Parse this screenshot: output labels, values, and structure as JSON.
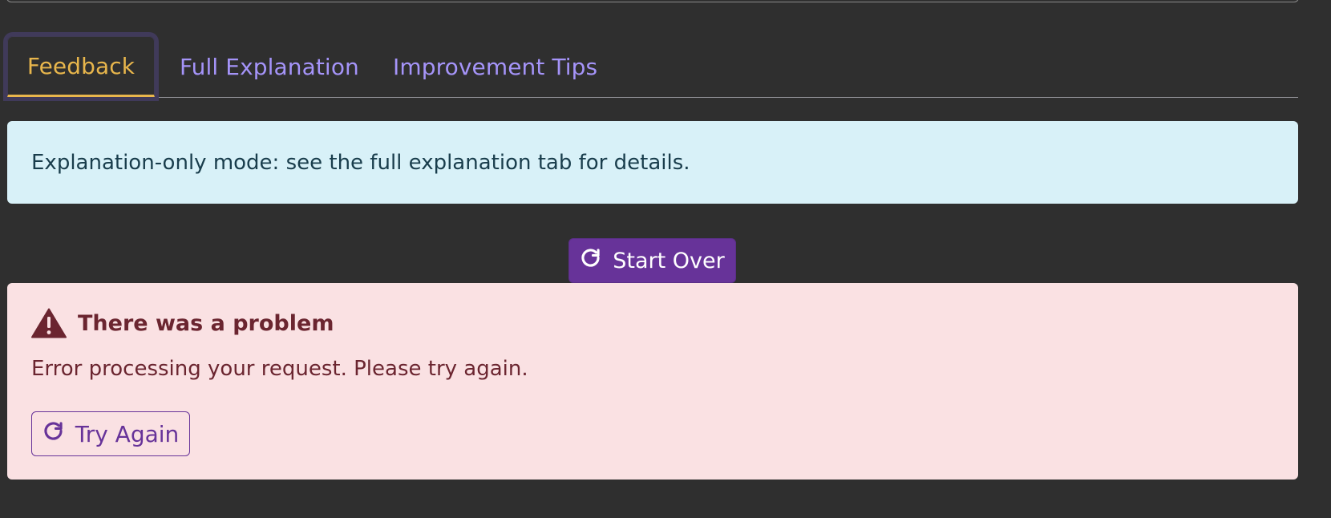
{
  "tabs": [
    {
      "label": "Feedback",
      "active": true
    },
    {
      "label": "Full Explanation",
      "active": false
    },
    {
      "label": "Improvement Tips",
      "active": false
    }
  ],
  "info_alert": {
    "text": "Explanation-only mode: see the full explanation tab for details."
  },
  "start_over": {
    "label": "Start Over",
    "icon": "refresh-icon"
  },
  "error_alert": {
    "heading": "There was a problem",
    "message": "Error processing your request. Please try again.",
    "icon": "warning-icon",
    "try_again_label": "Try Again",
    "try_again_icon": "refresh-icon"
  },
  "colors": {
    "background": "#2f2f2f",
    "active_tab": "#e8b64c",
    "inactive_tab": "#a594f9",
    "primary": "#673399",
    "info_bg": "#d8f1f8",
    "error_bg": "#fae1e3",
    "error_text": "#6b2530"
  }
}
